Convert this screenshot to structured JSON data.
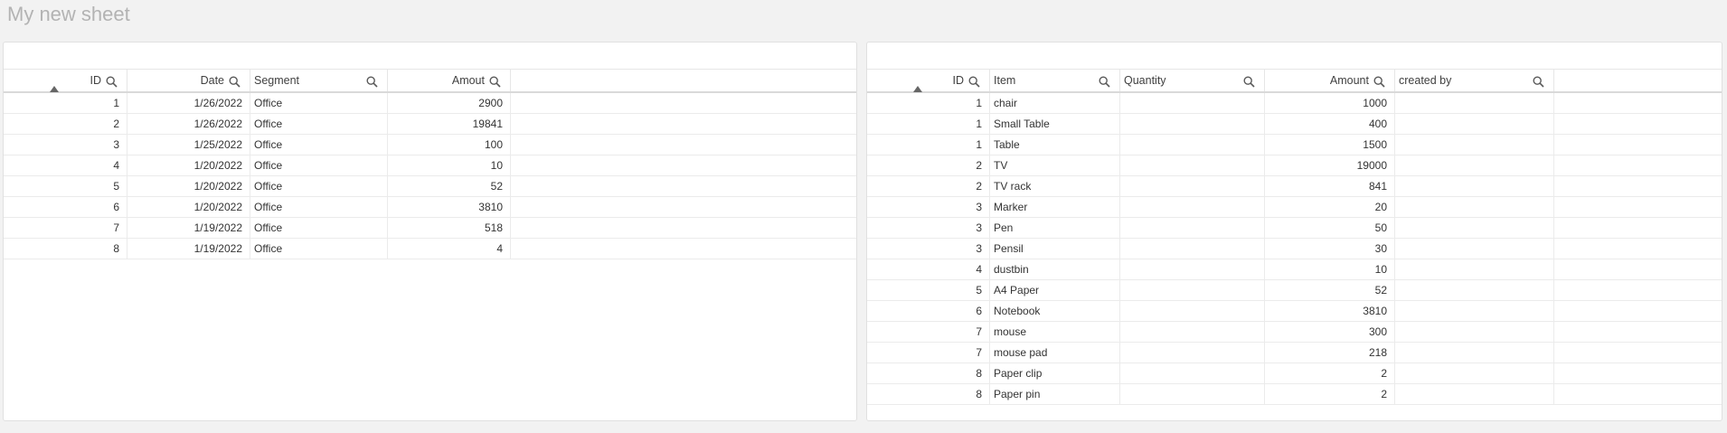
{
  "sheet": {
    "title": "My new sheet"
  },
  "left_table": {
    "columns": [
      {
        "key": "id",
        "label": "ID"
      },
      {
        "key": "date",
        "label": "Date"
      },
      {
        "key": "segment",
        "label": "Segment"
      },
      {
        "key": "amount",
        "label": "Amout"
      }
    ],
    "rows": [
      {
        "id": "1",
        "date": "1/26/2022",
        "segment": "Office",
        "amount": "2900"
      },
      {
        "id": "2",
        "date": "1/26/2022",
        "segment": "Office",
        "amount": "19841"
      },
      {
        "id": "3",
        "date": "1/25/2022",
        "segment": "Office",
        "amount": "100"
      },
      {
        "id": "4",
        "date": "1/20/2022",
        "segment": "Office",
        "amount": "10"
      },
      {
        "id": "5",
        "date": "1/20/2022",
        "segment": "Office",
        "amount": "52"
      },
      {
        "id": "6",
        "date": "1/20/2022",
        "segment": "Office",
        "amount": "3810"
      },
      {
        "id": "7",
        "date": "1/19/2022",
        "segment": "Office",
        "amount": "518"
      },
      {
        "id": "8",
        "date": "1/19/2022",
        "segment": "Office",
        "amount": "4"
      }
    ]
  },
  "right_table": {
    "columns": [
      {
        "key": "id",
        "label": "ID"
      },
      {
        "key": "item",
        "label": "Item"
      },
      {
        "key": "quantity",
        "label": "Quantity"
      },
      {
        "key": "amount",
        "label": "Amount"
      },
      {
        "key": "created_by",
        "label": "created by"
      }
    ],
    "rows": [
      {
        "id": "1",
        "item": "chair",
        "quantity": "",
        "amount": "1000",
        "created_by": ""
      },
      {
        "id": "1",
        "item": "Small Table",
        "quantity": "",
        "amount": "400",
        "created_by": ""
      },
      {
        "id": "1",
        "item": "Table",
        "quantity": "",
        "amount": "1500",
        "created_by": ""
      },
      {
        "id": "2",
        "item": "TV",
        "quantity": "",
        "amount": "19000",
        "created_by": ""
      },
      {
        "id": "2",
        "item": "TV rack",
        "quantity": "",
        "amount": "841",
        "created_by": ""
      },
      {
        "id": "3",
        "item": "Marker",
        "quantity": "",
        "amount": "20",
        "created_by": ""
      },
      {
        "id": "3",
        "item": "Pen",
        "quantity": "",
        "amount": "50",
        "created_by": ""
      },
      {
        "id": "3",
        "item": "Pensil",
        "quantity": "",
        "amount": "30",
        "created_by": ""
      },
      {
        "id": "4",
        "item": "dustbin",
        "quantity": "",
        "amount": "10",
        "created_by": ""
      },
      {
        "id": "5",
        "item": "A4 Paper",
        "quantity": "",
        "amount": "52",
        "created_by": ""
      },
      {
        "id": "6",
        "item": "Notebook",
        "quantity": "",
        "amount": "3810",
        "created_by": ""
      },
      {
        "id": "7",
        "item": "mouse",
        "quantity": "",
        "amount": "300",
        "created_by": ""
      },
      {
        "id": "7",
        "item": "mouse pad",
        "quantity": "",
        "amount": "218",
        "created_by": ""
      },
      {
        "id": "8",
        "item": "Paper clip",
        "quantity": "",
        "amount": "2",
        "created_by": ""
      },
      {
        "id": "8",
        "item": "Paper pin",
        "quantity": "",
        "amount": "2",
        "created_by": ""
      }
    ]
  }
}
